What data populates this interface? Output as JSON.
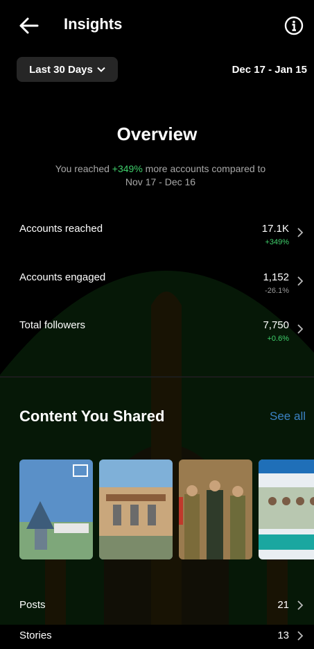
{
  "header": {
    "title": "Insights"
  },
  "filters": {
    "range_label": "Last 30 Days",
    "date_range": "Dec 17 - Jan 15"
  },
  "overview": {
    "title": "Overview",
    "sub_prefix": "You reached ",
    "sub_highlight": "+349%",
    "sub_suffix": " more accounts compared to",
    "sub_line2": "Nov 17 - Dec 16"
  },
  "metrics": [
    {
      "label": "Accounts reached",
      "value": "17.1K",
      "delta": "+349%",
      "positive": true
    },
    {
      "label": "Accounts engaged",
      "value": "1,152",
      "delta": "-26.1%",
      "positive": false
    },
    {
      "label": "Total followers",
      "value": "7,750",
      "delta": "+0.6%",
      "positive": true
    }
  ],
  "content": {
    "title": "Content You Shared",
    "see_all": "See all",
    "rows": [
      {
        "label": "Posts",
        "value": "21"
      },
      {
        "label": "Stories",
        "value": "13"
      }
    ]
  },
  "colors": {
    "background": "#000000",
    "positive": "#3fcf6b",
    "link": "#3b82c4",
    "button_bg": "#262626"
  }
}
